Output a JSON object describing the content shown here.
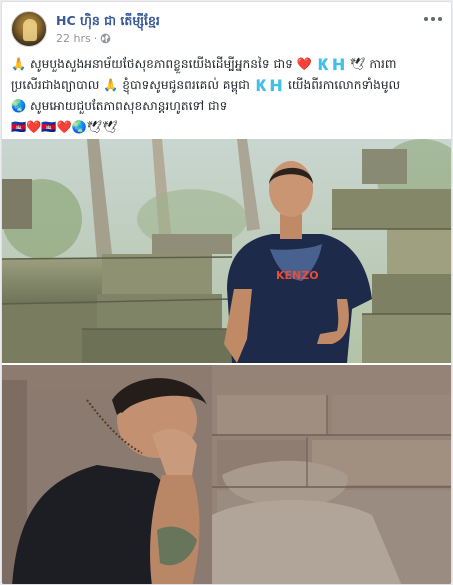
{
  "post": {
    "author": "HC ហ៊ិន ជា តេីម្ស៊ីខ្មែរ",
    "time": "22 hrs",
    "separator": "·",
    "privacy_icon": "globe-icon",
    "menu_icon": "more-icon",
    "text_lines": [
      "🙏 សូមបួងសួងអនាម័យថែសុខភាពខ្លួនយេីងដេីម្បីអ្នកនទៃ ជាទ ❤️ 🇰🇭 🕊 ការពា",
      "ប្រសើរជាងព្យាបាល 🙏 ខ្ញុំបាទសូមជូនពរគេល់ គម្ពុជា 🇰🇭 យេីងពីរកាលោកទាំងមូល",
      "🌏 សូមអោយជួបតែភាពសុខសាន្តរហូតទៅ ជាទ",
      "🇰🇭❤️🇰🇭❤️🌏🕊🕊"
    ],
    "photos": [
      {
        "shirt_text": "KENZO"
      },
      {}
    ]
  },
  "colors": {
    "link": "#385898",
    "text": "#1d2129",
    "meta": "#90949c",
    "card_bg": "#ffffff"
  }
}
